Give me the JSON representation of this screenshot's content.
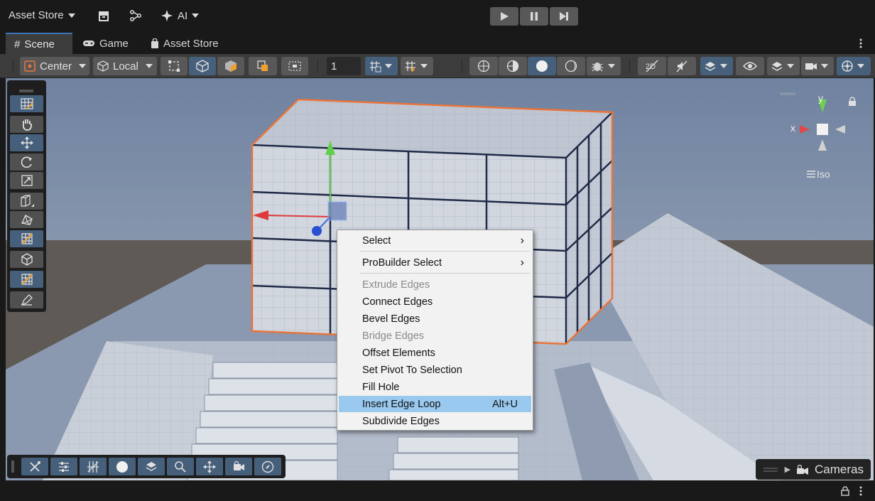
{
  "topbar": {
    "account_label": "Asset Store",
    "ai_label": "AI"
  },
  "tabs": [
    {
      "label": "Scene",
      "icon": "hash-icon",
      "active": true
    },
    {
      "label": "Game",
      "icon": "gamepad-icon",
      "active": false
    },
    {
      "label": "Asset Store",
      "icon": "bag-icon",
      "active": false
    }
  ],
  "toolbar": {
    "pivot_label": "Center",
    "space_label": "Local",
    "grid_size_value": "1"
  },
  "scene": {
    "gizmo": {
      "x_label": "x",
      "y_label": "y",
      "projection_label": "Iso"
    },
    "cameras_label": "Cameras"
  },
  "context_menu": {
    "items": [
      {
        "label": "Select",
        "submenu": true,
        "enabled": true
      },
      {
        "label": "ProBuilder Select",
        "submenu": true,
        "enabled": true
      },
      {
        "label": "Extrude Edges",
        "enabled": false
      },
      {
        "label": "Connect Edges",
        "enabled": true
      },
      {
        "label": "Bevel Edges",
        "enabled": true
      },
      {
        "label": "Bridge Edges",
        "enabled": false
      },
      {
        "label": "Offset Elements",
        "enabled": true
      },
      {
        "label": "Set Pivot To Selection",
        "enabled": true
      },
      {
        "label": "Fill Hole",
        "enabled": true
      },
      {
        "label": "Insert Edge Loop",
        "shortcut": "Alt+U",
        "enabled": true,
        "highlighted": true
      },
      {
        "label": "Subdivide Edges",
        "enabled": true
      }
    ],
    "submenu_arrow": "›"
  },
  "colors": {
    "accent": "#46607c",
    "tab_accent": "#3a79bb",
    "menu_highlight": "#99c9ef",
    "selection_outline": "#e8743b"
  }
}
